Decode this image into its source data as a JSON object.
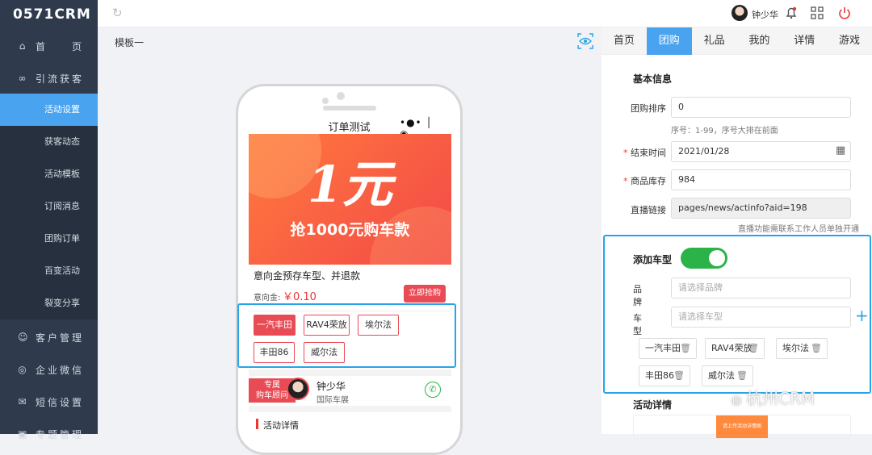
{
  "brand": {
    "logo": "0571CRM",
    "watermark": "杭州CRM"
  },
  "sidebar": {
    "items": [
      {
        "label": "首　　页",
        "icon": "home-icon"
      },
      {
        "label": "引流获客",
        "icon": "share-icon"
      }
    ],
    "sub_items": [
      "活动设置",
      "获客动态",
      "活动模板",
      "订阅消息",
      "团购订单",
      "百变活动",
      "裂变分享"
    ],
    "more_items": [
      {
        "label": "客户管理",
        "icon": "user-icon"
      },
      {
        "label": "企业微信",
        "icon": "wechat-icon"
      },
      {
        "label": "短信设置",
        "icon": "mail-icon"
      },
      {
        "label": "专题管理",
        "icon": "topic-icon"
      }
    ]
  },
  "topbar": {
    "username": "钟少华"
  },
  "editor": {
    "template_name": "模板一"
  },
  "phone": {
    "title": "订单测试",
    "banner_big": "1元",
    "banner_sub": "抢1000元购车款",
    "product_title": "意向金预存车型、并退款",
    "deposit_label": "意向金:",
    "deposit_value": "￥0.10",
    "buy_button": "立即抢购",
    "car_options": [
      "一汽丰田",
      "RAV4荣放",
      "埃尔法",
      "丰田86",
      "威尔法"
    ],
    "advisor_badge_line1": "专属",
    "advisor_badge_line2": "购车顾问",
    "advisor_name": "钟少华",
    "advisor_org": "国际车展",
    "detail_heading": "活动详情"
  },
  "tabs": [
    "首页",
    "团购",
    "礼品",
    "我的",
    "详情",
    "游戏"
  ],
  "form": {
    "section_basic": "基本信息",
    "sort_label": "团购排序",
    "sort_value": "0",
    "sort_hint": "序号：1-99，序号大排在前面",
    "end_label": "结束时间",
    "end_value": "2021/01/28",
    "stock_label": "商品库存",
    "stock_value": "984",
    "live_label": "直播链接",
    "live_value": "pages/news/actinfo?aid=198",
    "live_hint": "直播功能需联系工作人员单独开通",
    "add_car_label": "添加车型",
    "add_car_enabled": true,
    "brand_label": "品牌",
    "brand_placeholder": "请选择品牌",
    "model_label": "车型",
    "model_placeholder": "请选择车型",
    "chips": [
      "一汽丰田",
      "RAV4荣放",
      "埃尔法",
      "丰田86",
      "威尔法"
    ],
    "detail_section": "活动详情",
    "detail_thumb_text": "请上传活动详情图"
  }
}
